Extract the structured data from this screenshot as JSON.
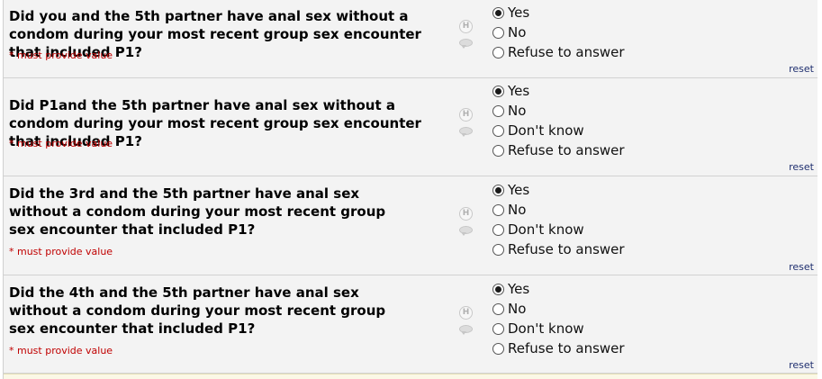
{
  "questions": [
    {
      "text": "Did you and the 5th partner have anal sex without a condom during your most recent group sex encounter that included P1?",
      "required": "* must provide value",
      "options": [
        "Yes",
        "No",
        "Refuse to answer"
      ],
      "selected": "Yes",
      "reset": "reset"
    },
    {
      "text": "Did P1and the 5th partner have anal sex without a condom during your most recent group sex encounter that included P1?",
      "required": "* must provide value",
      "options": [
        "Yes",
        "No",
        "Don't know",
        "Refuse to answer"
      ],
      "selected": "Yes",
      "reset": "reset"
    },
    {
      "text": "Did the 3rd and the 5th partner have anal sex without a condom during your most recent group sex encounter that included P1?",
      "required": "* must provide value",
      "options": [
        "Yes",
        "No",
        "Don't know",
        "Refuse to answer"
      ],
      "selected": "Yes",
      "reset": "reset"
    },
    {
      "text": "Did the 4th and the 5th partner have anal sex without a condom during your most recent group sex encounter that included P1?",
      "required": "* must provide value",
      "options": [
        "Yes",
        "No",
        "Don't know",
        "Refuse to answer"
      ],
      "selected": "Yes",
      "reset": "reset"
    }
  ],
  "icons": {
    "help": "H",
    "comment": "comment-bubble-icon"
  },
  "colors": {
    "required": "#c00000",
    "reset_link": "#1f2f6f",
    "row_bg": "#f3f3f3"
  }
}
